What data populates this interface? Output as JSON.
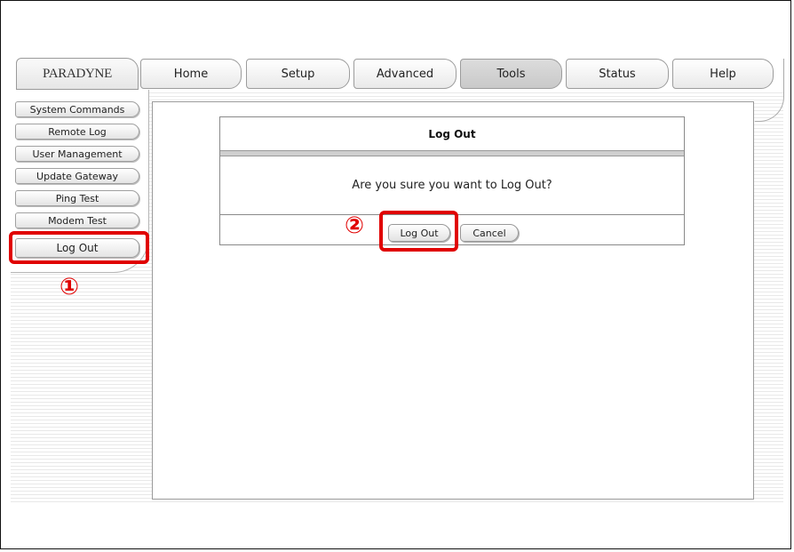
{
  "logo": "PARADYNE",
  "nav": {
    "tabs": [
      {
        "label": "Home"
      },
      {
        "label": "Setup"
      },
      {
        "label": "Advanced"
      },
      {
        "label": "Tools",
        "active": true
      },
      {
        "label": "Status"
      },
      {
        "label": "Help"
      }
    ]
  },
  "sidebar": {
    "items": [
      {
        "label": "System Commands"
      },
      {
        "label": "Remote Log"
      },
      {
        "label": "User Management"
      },
      {
        "label": "Update Gateway"
      },
      {
        "label": "Ping Test"
      },
      {
        "label": "Modem Test"
      },
      {
        "label": "Log Out"
      }
    ]
  },
  "dialog": {
    "title": "Log Out",
    "message": "Are you sure you want to Log Out?",
    "logout_label": "Log Out",
    "cancel_label": "Cancel"
  },
  "annotations": {
    "marker1": "①",
    "marker2": "②",
    "highlight_color": "#e00000"
  }
}
